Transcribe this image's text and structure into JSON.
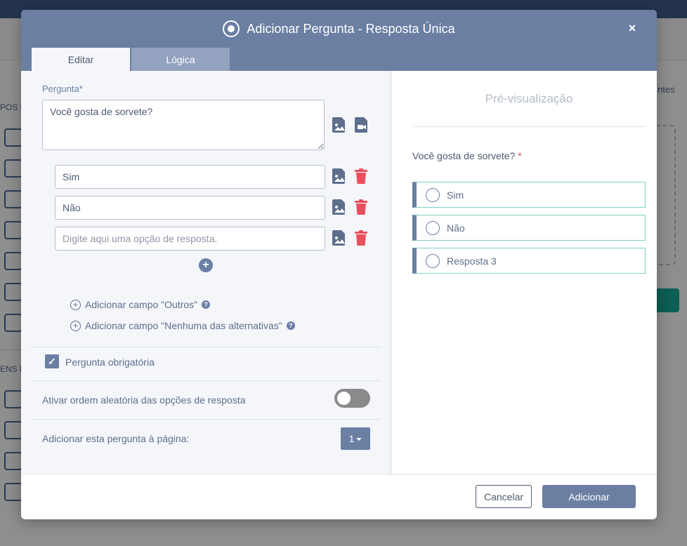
{
  "background": {
    "sidebar_labels": [
      "POS I",
      "ENS I"
    ],
    "right_text": "ntes"
  },
  "modal": {
    "title": "Adicionar Pergunta - Resposta Única",
    "close": "×",
    "tabs": [
      {
        "label": "Editar"
      },
      {
        "label": "Lógica"
      }
    ]
  },
  "editor": {
    "question_label": "Pergunta*",
    "question_value": "Você gosta de sorvete?",
    "options": [
      {
        "value": "Sim",
        "placeholder": ""
      },
      {
        "value": "Não",
        "placeholder": ""
      },
      {
        "value": "",
        "placeholder": "Digite aqui uma opção de resposta."
      }
    ],
    "add_other": "Adicionar campo \"Outros\"",
    "add_none": "Adicionar campo \"Nenhuma das alternativas\"",
    "required_label": "Pergunta obrigatória",
    "random_order_label": "Ativar ordem aleatória das opções de resposta",
    "page_label": "Adicionar esta pergunta à página:",
    "page_value": "1"
  },
  "preview": {
    "title": "Pré-visualização",
    "question": "Você gosta de sorvete?",
    "required_mark": "*",
    "options": [
      "Sim",
      "Não",
      "Resposta 3"
    ]
  },
  "footer": {
    "cancel": "Cancelar",
    "add": "Adicionar"
  },
  "colors": {
    "header": "#6b7fa3",
    "trash": "#e8505b",
    "accent_border": "#7fd1c7"
  }
}
